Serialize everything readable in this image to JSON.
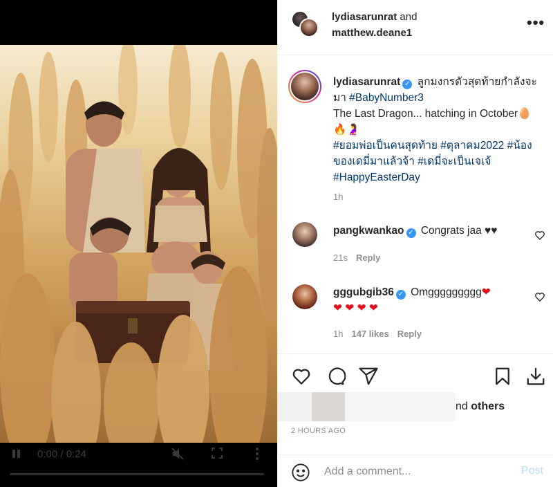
{
  "video": {
    "time": "0:00 / 0:24",
    "progress": 0
  },
  "header": {
    "user1": "lydiasarunrat",
    "and_word": "and",
    "user2": "matthew.deane1",
    "more": "•••"
  },
  "caption": {
    "username": "lydiasarunrat",
    "verified": "✓",
    "text1": "ลูกมงกรตัวสุดท้ายกำลังจะมา",
    "tag1": "#BabyNumber3",
    "text2": "The Last Dragon... hatching in October🥚",
    "emoji": "🔥🤰",
    "tag2": "#ยอมพ่อเป็นคนสุดท้าย",
    "tag3": "#ตุลาคม2022",
    "tag4": "#น้องของเดมี่มาแล้วจ้า",
    "tag5": "#เดมี่จะเป็นเจเจ้",
    "tag6": "#HappyEasterDay",
    "time": "1h"
  },
  "comments": [
    {
      "username": "pangkwankao",
      "text": "Congrats jaa ♥♥",
      "time": "21s",
      "likes": "",
      "reply": "Reply"
    },
    {
      "username": "gggubgib36",
      "text": "Omggggggggg",
      "hearts_inline": "❤",
      "hearts": "❤ ❤ ❤ ❤",
      "time": "1h",
      "likes": "147 likes",
      "reply": "Reply"
    }
  ],
  "likes": {
    "suffix_visible": "nd",
    "others": "others"
  },
  "time_ago": "2 HOURS AGO",
  "add_comment": {
    "placeholder": "Add a comment...",
    "post": "Post"
  },
  "icons": [
    "heart-icon",
    "comment-icon",
    "share-icon",
    "bookmark-icon",
    "download-icon",
    "emoji-icon",
    "pause-icon",
    "mute-icon",
    "fullscreen-icon",
    "more-vertical-icon",
    "more-horizontal-icon",
    "verified-badge"
  ],
  "colors": {
    "link": "#00376b",
    "verified": "#3897f0",
    "post_disabled": "#b2dffc",
    "heart": "#e0101d"
  }
}
